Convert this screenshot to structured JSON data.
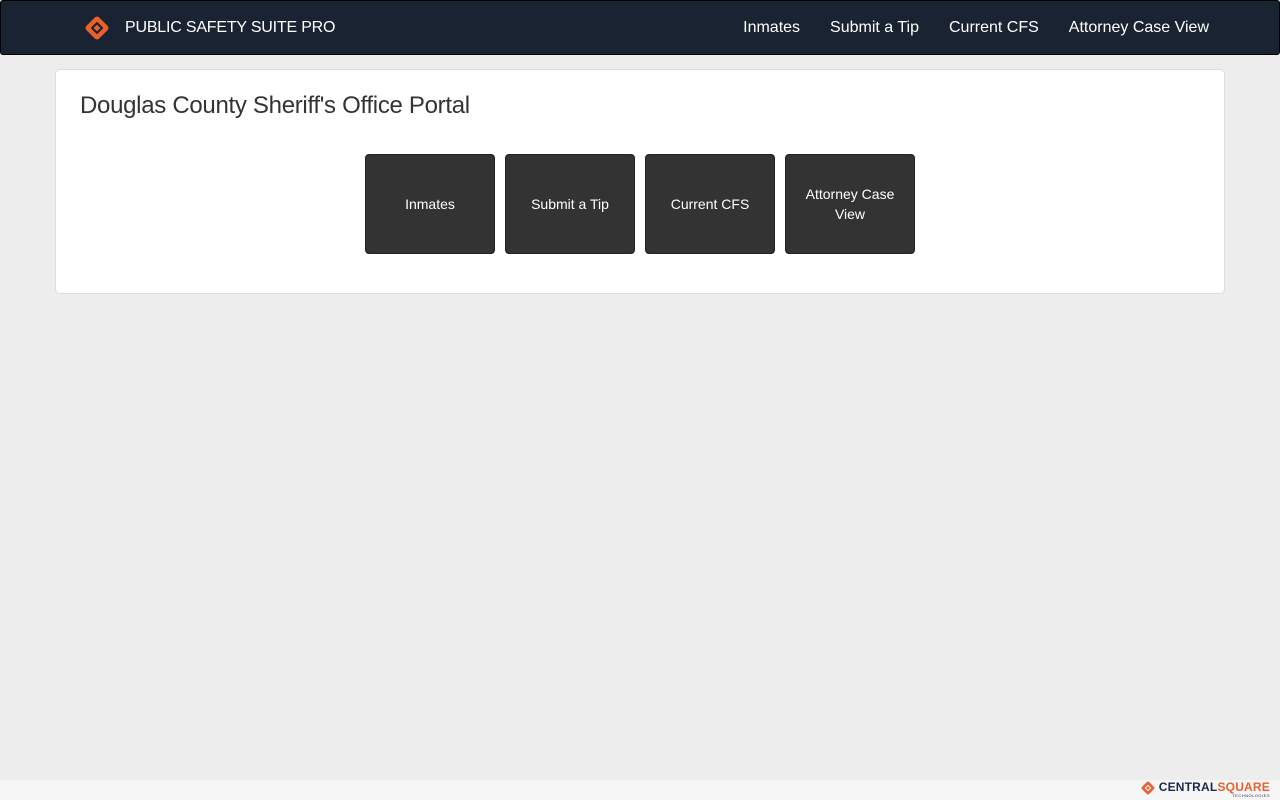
{
  "header": {
    "brand_title": "PUBLIC SAFETY SUITE PRO",
    "logo_icon": "diamond-logo-icon",
    "nav": [
      {
        "label": "Inmates"
      },
      {
        "label": "Submit a Tip"
      },
      {
        "label": "Current CFS"
      },
      {
        "label": "Attorney Case View"
      }
    ]
  },
  "main": {
    "title": "Douglas County Sheriff's Office Portal",
    "tiles": [
      {
        "label": "Inmates"
      },
      {
        "label": "Submit a Tip"
      },
      {
        "label": "Current CFS"
      },
      {
        "label": "Attorney Case View"
      }
    ]
  },
  "footer": {
    "brand_part1": "CENTRAL",
    "brand_part2": "SQUARE",
    "brand_sub": "TECHNOLOGIES",
    "logo_icon": "centralsquare-logo-icon"
  },
  "colors": {
    "navbar_bg": "#192331",
    "accent_orange": "#e8602c",
    "tile_bg": "#333333",
    "page_bg": "#ededed"
  }
}
